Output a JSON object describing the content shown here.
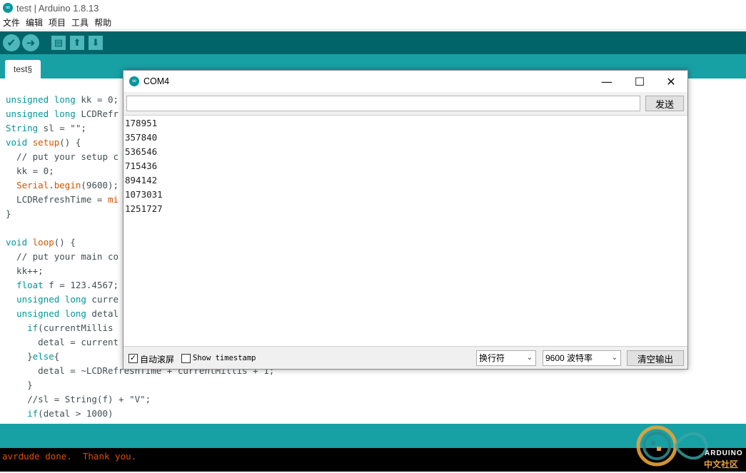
{
  "window": {
    "title": "test | Arduino 1.8.13"
  },
  "menu": [
    "文件",
    "编辑",
    "项目",
    "工具",
    "帮助"
  ],
  "toolbar": {
    "verify_icon": "checkmark-icon",
    "upload_icon": "arrow-right-icon",
    "new_icon": "new-file-icon",
    "open_icon": "open-up-arrow-icon",
    "save_icon": "save-down-arrow-icon"
  },
  "tab": {
    "label": "test§"
  },
  "editor": {
    "lines": [
      "unsigned long kk = 0;",
      "unsigned long LCDRefr",
      "String sl = \"\";",
      "void setup() {",
      "  // put your setup c",
      "  kk = 0;",
      "  Serial.begin(9600);",
      "  LCDRefreshTime = mi",
      "}",
      "",
      "void loop() {",
      "  // put your main co",
      "  kk++;",
      "  float f = 123.4567;",
      "  unsigned long curre",
      "  unsigned long detal",
      "    if(currentMillis",
      "      detal = current",
      "    }else{",
      "      detal = ~LCDRefreshTime + currentMillis + 1;",
      "    }",
      "    //sl = String(f) + \"V\";",
      "    if(detal > 1000)"
    ]
  },
  "console": {
    "message": "avrdude done.  Thank you."
  },
  "watermark": {
    "brand": "ARDUINO",
    "sub": "中文社区"
  },
  "serial_monitor": {
    "title": "COM4",
    "minimize": "—",
    "maximize": "☐",
    "close": "✕",
    "input_value": "",
    "send_label": "发送",
    "output_lines": [
      "178951",
      "357840",
      "536546",
      "715436",
      "894142",
      "1073031",
      "1251727"
    ],
    "autoscroll_label": "自动滚屏",
    "autoscroll_checked": "✓",
    "timestamp_label": "Show timestamp",
    "line_ending": "换行符",
    "baud_rate": "9600 波特率",
    "clear_label": "清空输出"
  },
  "colors": {
    "toolbar": "#006468",
    "accent": "#17a1a5",
    "keyword": "#00979c",
    "function": "#d35400",
    "console_text": "#e34c00"
  }
}
